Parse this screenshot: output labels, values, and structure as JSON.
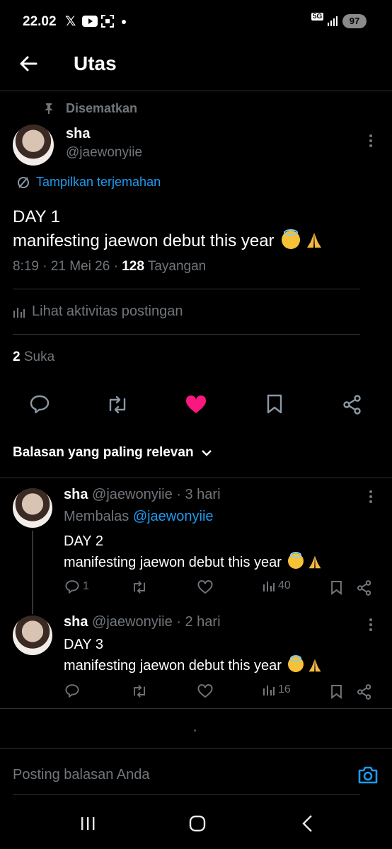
{
  "status_bar": {
    "time": "22.02",
    "network": "5G",
    "battery": "97"
  },
  "header": {
    "title": "Utas"
  },
  "pinned_label": "Disematkan",
  "main_post": {
    "name": "sha",
    "handle": "@jaewonyiie",
    "translate": "Tampilkan terjemahan",
    "line1": "DAY 1",
    "line2": "manifesting jaewon debut this year",
    "time": "8:19 · 21 Mei 26 · ",
    "views": "128",
    "views_label": " Tayangan",
    "activity": "Lihat aktivitas postingan",
    "likes": "2",
    "likes_label": " Suka"
  },
  "sort_label": "Balasan yang paling relevan",
  "replies": [
    {
      "name": "sha",
      "meta": " @jaewonyiie · 3 hari",
      "replying": "Membalas ",
      "replying_to": "@jaewonyiie",
      "line1": "DAY 2",
      "line2": "manifesting jaewon debut this year",
      "reply_count": "1",
      "views": "40"
    },
    {
      "name": "sha",
      "meta": " @jaewonyiie · 2 hari",
      "line1": "DAY 3",
      "line2": "manifesting jaewon debut this year",
      "views": "16"
    }
  ],
  "reply_placeholder": "Posting balasan Anda",
  "colors": {
    "like": "#f91880",
    "link": "#1d9bf0",
    "border": "#2f3336",
    "muted": "#71767b"
  }
}
